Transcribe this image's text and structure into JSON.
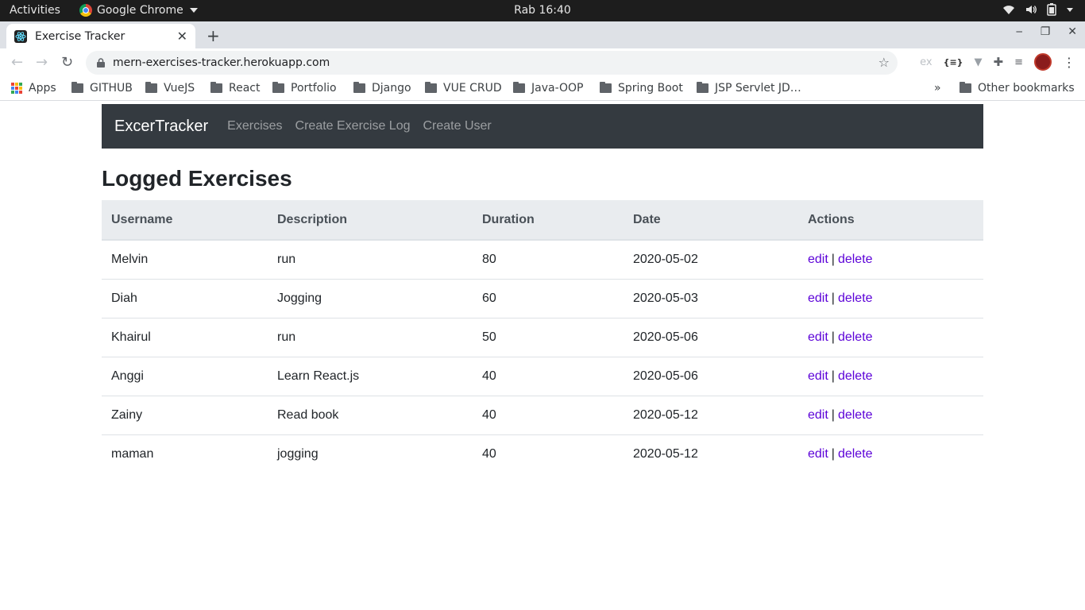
{
  "os": {
    "activities": "Activities",
    "app_name": "Google Chrome",
    "clock": "Rab 16:40"
  },
  "browser": {
    "tab_title": "Exercise Tracker",
    "url": "mern-exercises-tracker.herokuapp.com",
    "bookmarks": [
      "Apps",
      "GITHUB",
      "VueJS",
      "React",
      "Portfolio",
      "Django",
      "VUE CRUD",
      "Java-OOP",
      "Spring Boot",
      "JSP Servlet JD…"
    ],
    "overflow": "»",
    "other_bookmarks": "Other bookmarks",
    "ext_label": "ex"
  },
  "navbar": {
    "brand": "ExcerTracker",
    "links": [
      "Exercises",
      "Create Exercise Log",
      "Create User"
    ]
  },
  "page": {
    "title": "Logged Exercises",
    "columns": [
      "Username",
      "Description",
      "Duration",
      "Date",
      "Actions"
    ],
    "rows": [
      {
        "username": "Melvin",
        "description": "run",
        "duration": "80",
        "date": "2020-05-02"
      },
      {
        "username": "Diah",
        "description": "Jogging",
        "duration": "60",
        "date": "2020-05-03"
      },
      {
        "username": "Khairul",
        "description": "run",
        "duration": "50",
        "date": "2020-05-06"
      },
      {
        "username": "Anggi",
        "description": "Learn React.js",
        "duration": "40",
        "date": "2020-05-06"
      },
      {
        "username": "Zainy",
        "description": "Read book",
        "duration": "40",
        "date": "2020-05-12"
      },
      {
        "username": "maman",
        "description": "jogging",
        "duration": "40",
        "date": "2020-05-12"
      }
    ],
    "edit_label": "edit",
    "separator": "|",
    "delete_label": "delete"
  },
  "colors": {
    "navbar_bg": "#343a40",
    "link": "#5b00d8",
    "thead_bg": "#e9ecef"
  }
}
